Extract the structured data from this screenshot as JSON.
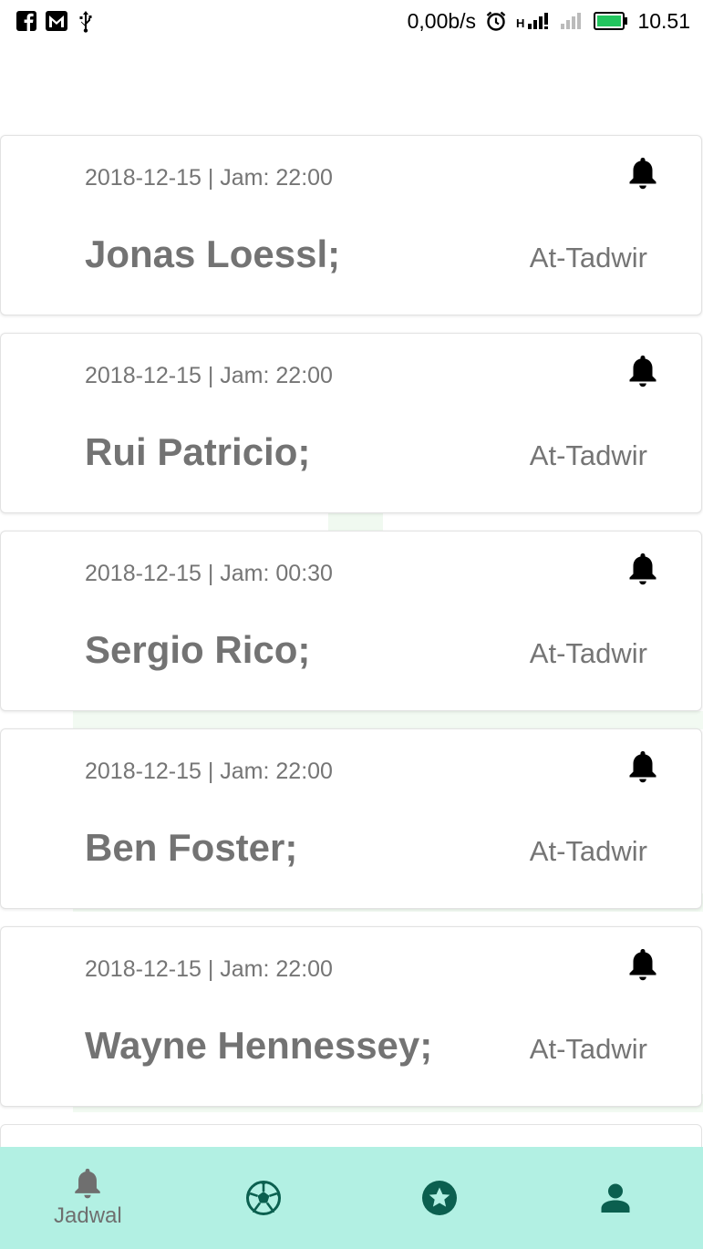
{
  "status_bar": {
    "net_speed": "0,00b/s",
    "network_type": "H",
    "time": "10.51",
    "left_icons": [
      "facebook-icon",
      "gmail-icon",
      "usb-icon"
    ],
    "battery_color": "#22c55e"
  },
  "matches": [
    {
      "date": "2018-12-15 | Jam: 22:00",
      "name": "Jonas Loessl;",
      "team": "At-Tadwir"
    },
    {
      "date": "2018-12-15 | Jam: 22:00",
      "name": "Rui Patricio;",
      "team": "At-Tadwir"
    },
    {
      "date": "2018-12-15 | Jam: 00:30",
      "name": "Sergio Rico;",
      "team": "At-Tadwir"
    },
    {
      "date": "2018-12-15 | Jam: 22:00",
      "name": "Ben Foster;",
      "team": "At-Tadwir"
    },
    {
      "date": "2018-12-15 | Jam: 22:00",
      "name": "Wayne Hennessey;",
      "team": "At-Tadwir"
    }
  ],
  "bottom_nav": {
    "items": [
      {
        "label": "Jadwal",
        "icon": "bell-icon",
        "active": true
      },
      {
        "label": "",
        "icon": "soccer-ball-icon"
      },
      {
        "label": "",
        "icon": "star-icon"
      },
      {
        "label": "",
        "icon": "person-icon"
      }
    ],
    "background": "#b2f0e3",
    "icon_color": "#0b5f4f"
  }
}
